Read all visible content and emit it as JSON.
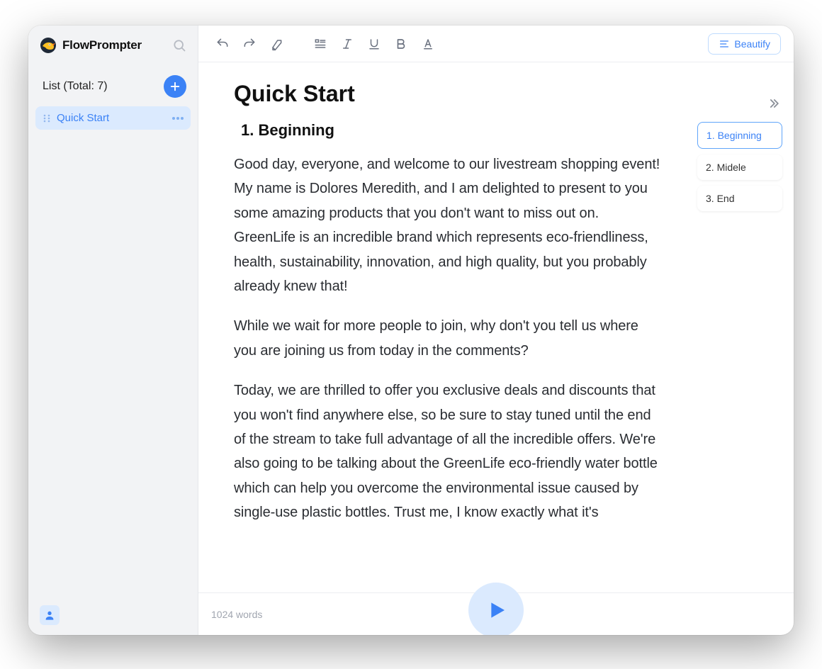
{
  "brand": {
    "name": "FlowPrompter"
  },
  "sidebar": {
    "list_label": "List (Total: 7)",
    "items": [
      {
        "label": "Quick Start"
      }
    ]
  },
  "toolbar": {
    "beautify_label": "Beautify"
  },
  "document": {
    "title": "Quick Start",
    "sections": [
      {
        "heading": "1. Beginning"
      }
    ],
    "paragraphs": [
      "Good day, everyone, and welcome to our livestream shopping event! My name is Dolores Meredith, and I am delighted to present to you some amazing products that you don't want to miss out on. GreenLife is an incredible brand which represents eco-friendliness, health, sustainability, innovation, and high quality, but you probably already knew that!",
      "While we wait for more people to join, why don't you tell us where you are joining us from today in the comments?",
      "Today, we are thrilled to offer you exclusive deals and discounts that you won't find anywhere else, so be sure to stay tuned until the end of the stream to take full advantage of all the incredible offers. We're also going to be talking about the GreenLife eco-friendly water bottle which can help you overcome the environmental issue caused by single-use plastic bottles. Trust me, I know exactly what it's"
    ]
  },
  "outline": {
    "items": [
      {
        "label": "1. Beginning"
      },
      {
        "label": "2. Midele"
      },
      {
        "label": "3. End"
      }
    ]
  },
  "footer": {
    "word_count": "1024 words"
  }
}
